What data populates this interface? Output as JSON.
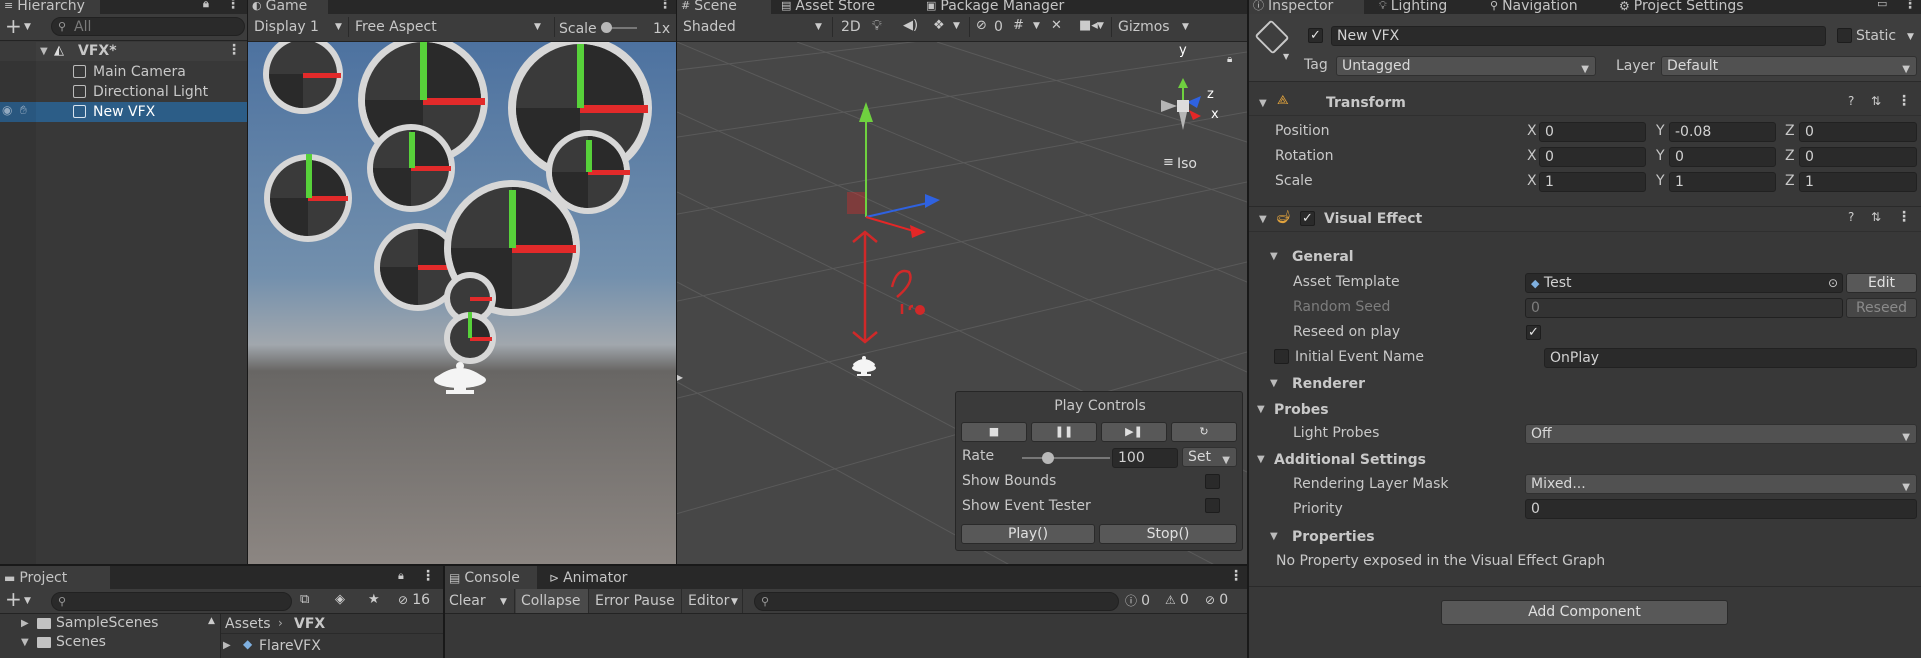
{
  "hierarchy": {
    "tab": "Hierarchy",
    "search_placeholder": "All",
    "scene": "VFX*",
    "items": [
      "Main Camera",
      "Directional Light",
      "New VFX"
    ]
  },
  "game": {
    "tab": "Game",
    "display": "Display 1",
    "aspect": "Free Aspect",
    "scale_label": "Scale",
    "scale_value": "1x"
  },
  "scene": {
    "tabs": [
      "Scene",
      "Asset Store",
      "Package Manager"
    ],
    "shading": "Shaded",
    "mode_2d": "2D",
    "hidden_count": "0",
    "gizmos": "Gizmos",
    "gizmo_axes": {
      "y": "y",
      "x": "x",
      "z": "z"
    },
    "iso": "Iso",
    "play_controls": {
      "title": "Play Controls",
      "rate_label": "Rate",
      "rate_value": "100",
      "rate_fraction": 0.3,
      "set_label": "Set",
      "show_bounds": "Show Bounds",
      "show_event_tester": "Show Event Tester",
      "play_button": "Play()",
      "stop_button": "Stop()"
    }
  },
  "inspector": {
    "tabs": [
      "Inspector",
      "Lighting",
      "Navigation",
      "Project Settings"
    ],
    "object_name": "New VFX",
    "static_label": "Static",
    "tag_label": "Tag",
    "tag_value": "Untagged",
    "layer_label": "Layer",
    "layer_value": "Default",
    "transform": {
      "title": "Transform",
      "position_label": "Position",
      "rotation_label": "Rotation",
      "scale_label": "Scale",
      "axis": [
        "X",
        "Y",
        "Z"
      ],
      "position": [
        "0",
        "-0.08",
        "0"
      ],
      "rotation": [
        "0",
        "0",
        "0"
      ],
      "scale": [
        "1",
        "1",
        "1"
      ]
    },
    "visual_effect": {
      "title": "Visual Effect",
      "general": "General",
      "asset_template_label": "Asset Template",
      "asset_template_value": "Test",
      "edit_button": "Edit",
      "random_seed_label": "Random Seed",
      "random_seed_value": "0",
      "reseed_button": "Reseed",
      "reseed_on_play_label": "Reseed on play",
      "initial_event_label": "Initial Event Name",
      "initial_event_value": "OnPlay",
      "renderer": "Renderer",
      "probes": "Probes",
      "light_probes_label": "Light Probes",
      "light_probes_value": "Off",
      "additional_settings": "Additional Settings",
      "rendering_layer_label": "Rendering Layer Mask",
      "rendering_layer_value": "Mixed...",
      "priority_label": "Priority",
      "priority_value": "0",
      "properties": "Properties",
      "no_property": "No Property exposed in the Visual Effect Graph"
    },
    "add_component": "Add Component"
  },
  "project": {
    "tab": "Project",
    "hidden_count": "16",
    "tree": [
      "SampleScenes",
      "Scenes"
    ],
    "breadcrumb_root": "Assets",
    "breadcrumb_current": "VFX",
    "asset": "FlareVFX"
  },
  "console": {
    "tab": "Console",
    "animator_tab": "Animator",
    "clear": "Clear",
    "collapse": "Collapse",
    "error_pause": "Error Pause",
    "editor": "Editor",
    "info_count": "0",
    "warn_count": "0",
    "error_count": "0"
  },
  "colors": {
    "selection": "#2c5d87",
    "axis_x": "#e42727",
    "axis_y": "#6fd13f",
    "axis_z": "#2f62e0"
  }
}
